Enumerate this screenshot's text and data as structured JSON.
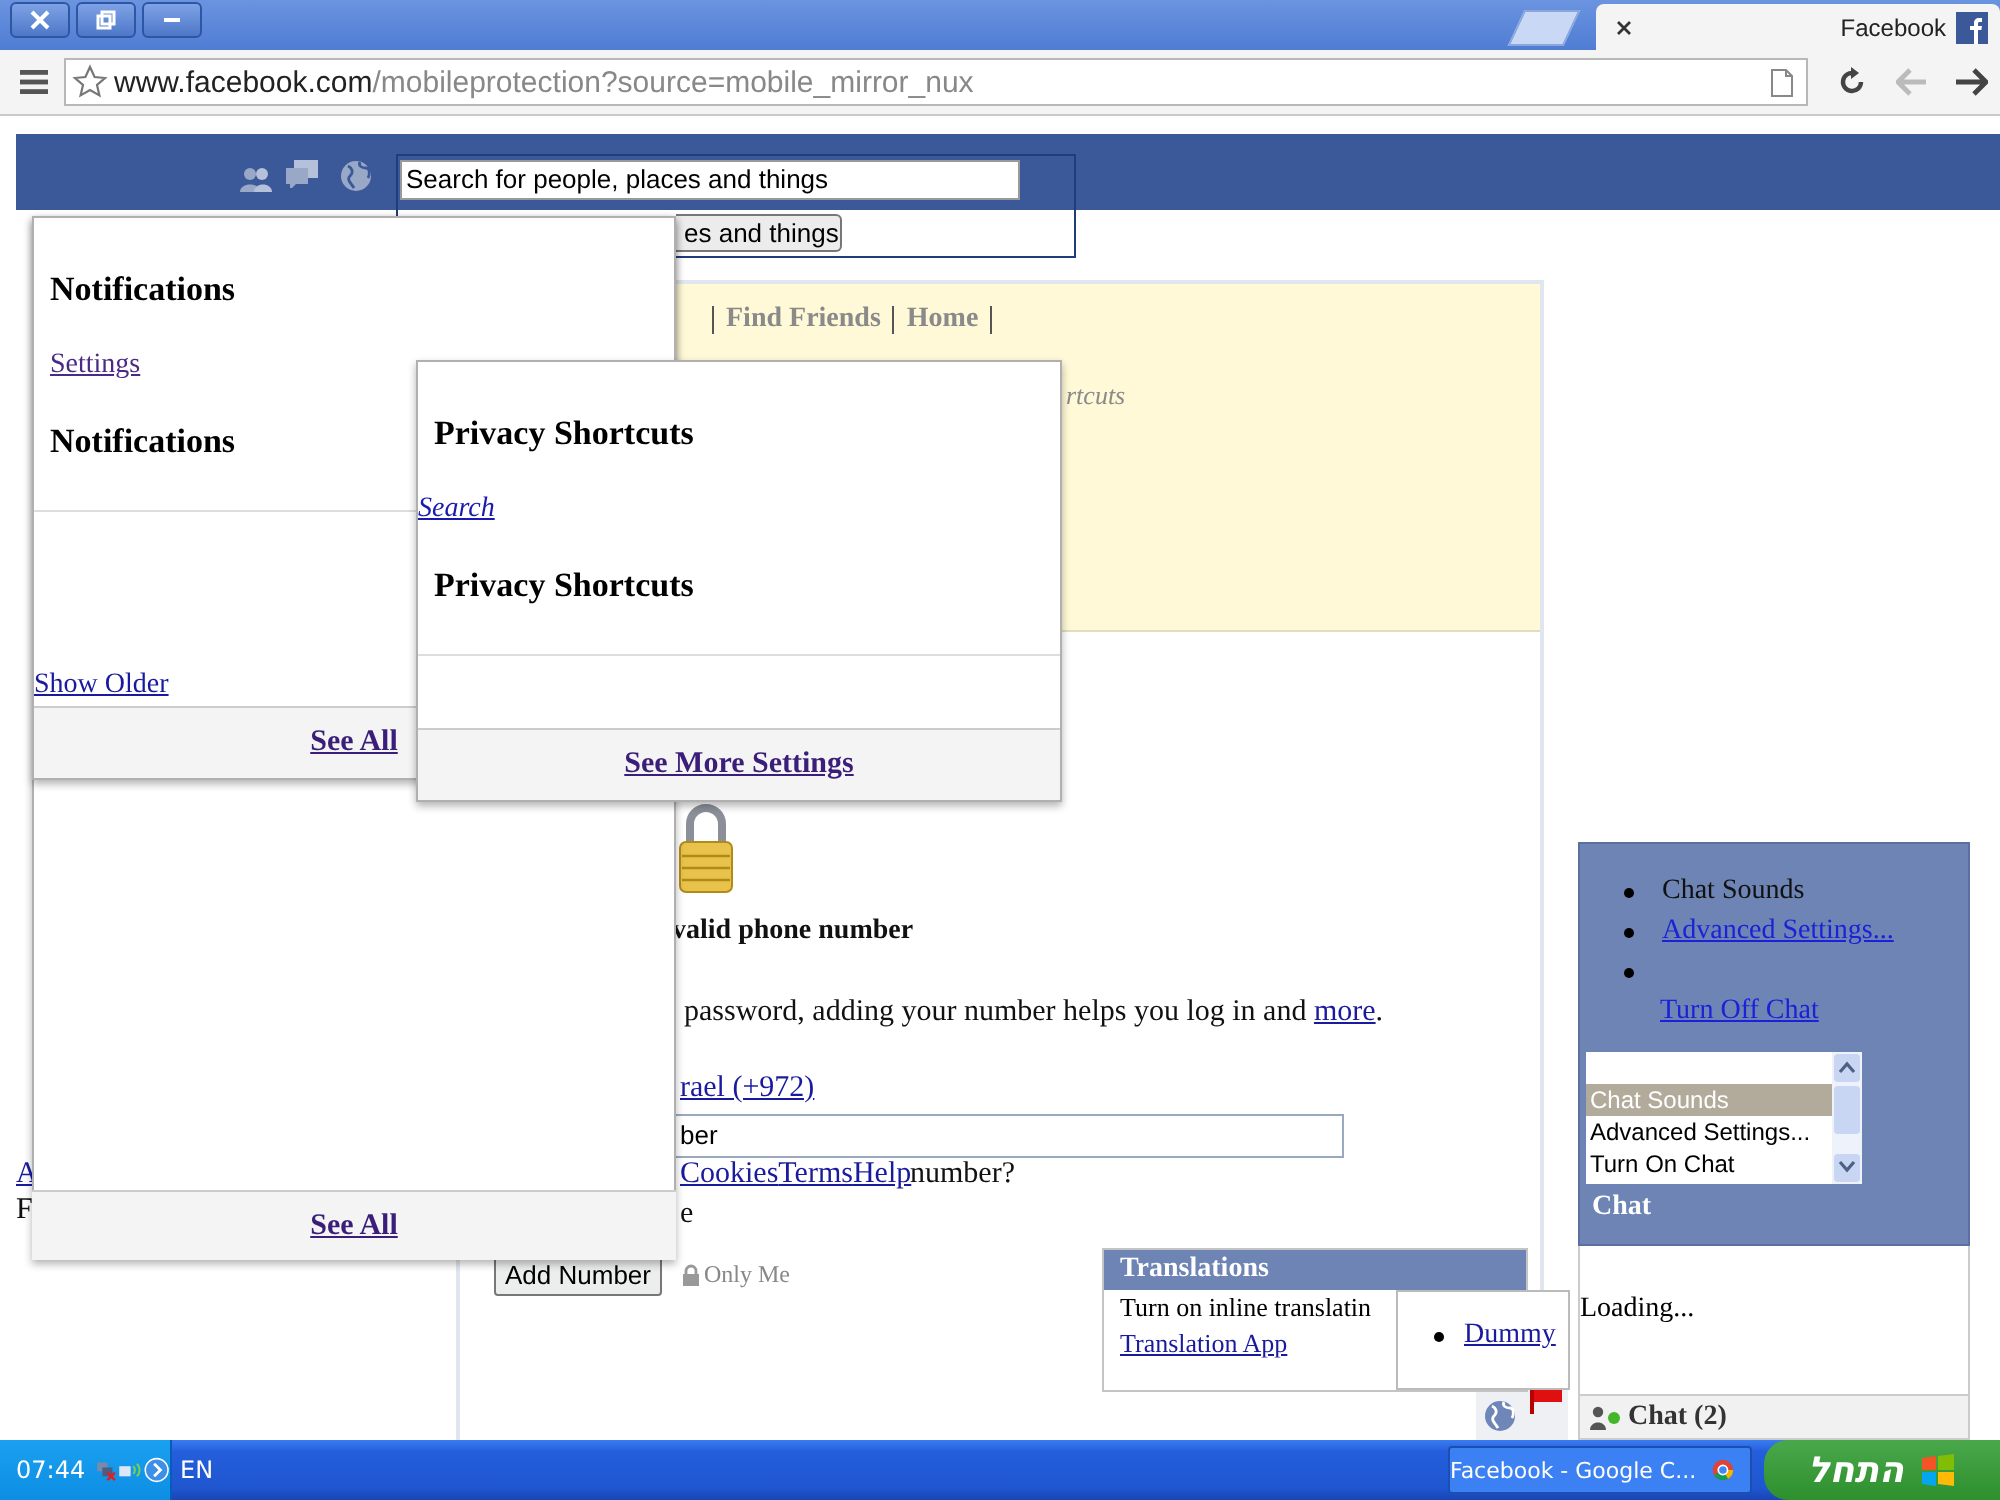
{
  "tabs": [
    {
      "label": "Facebook",
      "selected": true
    }
  ],
  "address_bar": {
    "domain": "www.facebook.com",
    "path": "/mobileprotection?source=mobile_mirror_nux"
  },
  "header": {
    "search": {
      "value": "Search for people, places and things"
    },
    "search_button": "es and things"
  },
  "nav": {
    "links": [
      "Find Friends",
      "Home"
    ],
    "faded_text": "rtcuts"
  },
  "notifications_popup": {
    "title": "Notifications",
    "settings": "Settings",
    "subtitle": "Notifications",
    "show_older": "Show Older",
    "footer": "See All"
  },
  "back_panel": {
    "footer": "See All"
  },
  "privacy_popup": {
    "title": "Privacy Shortcuts",
    "search": "Search",
    "subtitle": "Privacy Shortcuts",
    "footer": "See More Settings"
  },
  "phone_form": {
    "heading": "valid phone number",
    "text": "password, adding your number helps you log in and ",
    "link": "more",
    "text_end": ".",
    "country": "rael (+972)",
    "phone": "ber",
    "footer_links": [
      "Cookies",
      "Terms",
      "Help"
    ],
    "question": "number?",
    "note": "e",
    "add_button": "Add Number",
    "audience": "Only Me"
  },
  "left_fragments": [
    {
      "label": "A",
      "kind": "link"
    },
    {
      "label": "F",
      "kind": "text"
    }
  ],
  "translations": {
    "title": "Translations",
    "option": "Turn on inline translatin",
    "app": "Translation App"
  },
  "dummy_menu": {
    "items": [
      "Dummy"
    ]
  },
  "chat": {
    "menu": [
      {
        "label": "Chat Sounds",
        "kind": "text"
      },
      {
        "label": "Advanced Settings...",
        "kind": "link"
      },
      {
        "kind": "blank"
      },
      {
        "label": "Turn Off Chat",
        "kind": "sublink"
      }
    ],
    "options": [
      {
        "label": "Chat Sounds",
        "selected": true
      },
      {
        "label": "Advanced Settings...",
        "selected": false
      },
      {
        "label": "Turn On Chat",
        "selected": false
      }
    ],
    "title": "Chat",
    "status": "Loading...",
    "bar_label": "Chat (2)"
  },
  "taskbar": {
    "clock": "07:44",
    "language": "EN",
    "tasks": [
      {
        "label": "Facebook - Google C...",
        "selected": false
      }
    ],
    "start": "התחל"
  }
}
